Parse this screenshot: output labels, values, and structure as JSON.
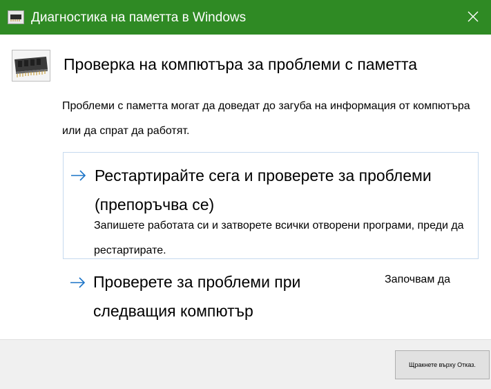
{
  "window": {
    "title": "Диагностика на паметта в Windows",
    "icon": "memory-chip-icon",
    "close_icon": "close-icon",
    "accent": "#2f8a24"
  },
  "header": {
    "icon": "memory-module-icon",
    "title": "Проверка на компютъра за проблеми с паметта"
  },
  "description": "Проблеми с паметта могат да доведат до загуба на информация от компютъра или да спрат да работят.",
  "options": [
    {
      "icon": "arrow-right-icon",
      "title": "Рестартирайте сега и проверете за проблеми (препоръчва се)",
      "description": "Запишете работата си и затворете всички отворени програми, преди да рестартирате."
    },
    {
      "icon": "arrow-right-icon",
      "title": "Проверете за проблеми при следващия компютър"
    }
  ],
  "tooltip": "Започвам да",
  "footer": {
    "cancel_label": "Щракнете върху Отказ."
  },
  "colors": {
    "titlebar": "#2f8a24",
    "arrow": "#1a73c7",
    "option_border": "#c5d9ee",
    "footer_bg": "#f0f0f0"
  }
}
